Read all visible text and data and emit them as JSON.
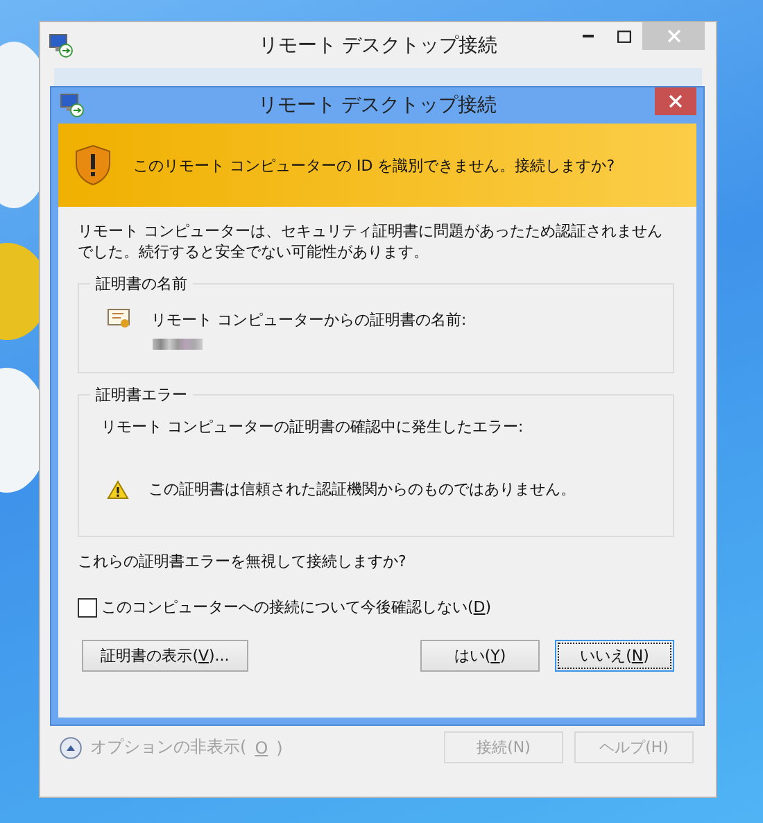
{
  "back_window": {
    "title": "リモート デスクトップ接続",
    "options_link": {
      "parts": [
        "オプションの非表示(",
        "O",
        ")"
      ],
      "disabled": true
    },
    "buttons": [
      {
        "parts": [
          "接続(N)"
        ],
        "disabled": true
      },
      {
        "parts": [
          "ヘルプ(H)"
        ],
        "disabled": true
      }
    ]
  },
  "dialog": {
    "title": "リモート デスクトップ接続",
    "banner": "このリモート コンピューターの ID を識別できません。接続しますか?",
    "message": "リモート コンピューターは、セキュリティ証明書に問題があったため認証されませんでした。続行すると安全でない可能性があります。",
    "groups": [
      {
        "kind": "name",
        "legend": "証明書の名前",
        "text": "リモート コンピューターからの証明書の名前:"
      },
      {
        "kind": "error",
        "legend": "証明書エラー",
        "text": "リモート コンピューターの証明書の確認中に発生したエラー:",
        "warning": "この証明書は信頼された認証機関からのものではありません。"
      }
    ],
    "question": "これらの証明書エラーを無視して接続しますか?",
    "checkbox": {
      "parts": [
        "このコンピューターへの接続について今後確認しない(",
        "D",
        ")"
      ],
      "checked": false
    },
    "buttons": [
      {
        "parts": [
          "証明書の表示(",
          "V",
          ")..."
        ],
        "focused": false
      },
      {
        "parts": [
          "はい(",
          "Y",
          ")"
        ],
        "focused": false
      },
      {
        "parts": [
          "いいえ(",
          "N",
          ")"
        ],
        "focused": true
      }
    ]
  }
}
